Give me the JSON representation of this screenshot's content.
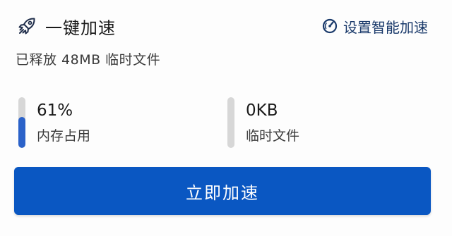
{
  "header": {
    "title": "一键加速",
    "icon": "rocket-icon"
  },
  "smart_accel": {
    "label": "设置智能加速",
    "icon": "speedometer-icon"
  },
  "status": {
    "released_text": "已释放 48MB 临时文件"
  },
  "memory": {
    "value": "61%",
    "label": "内存占用",
    "fill_percent": 61
  },
  "temp_files": {
    "value": "0KB",
    "label": "临时文件",
    "fill_percent": 0
  },
  "action": {
    "button_label": "立即加速"
  },
  "colors": {
    "accent": "#0a57c2",
    "bar_fill": "#2b62c9",
    "bar_track": "#d7d7d7",
    "icon_dark": "#1a3a6b"
  }
}
